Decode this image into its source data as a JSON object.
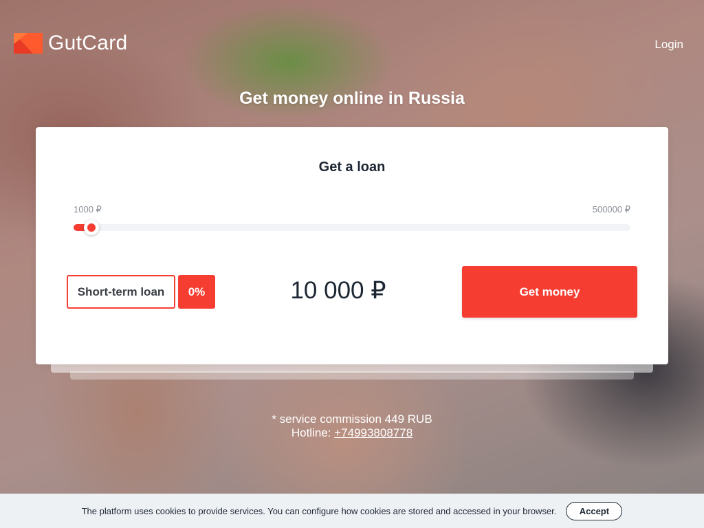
{
  "brand": {
    "name": "GutCard",
    "accent_color": "#f53d32",
    "logo_icon": "flag-logo-icon"
  },
  "header": {
    "login_label": "Login"
  },
  "hero": {
    "title": "Get money online in Russia"
  },
  "loan_card": {
    "title": "Get a loan",
    "slider": {
      "min_label": "1000 ₽",
      "max_label": "500000 ₽",
      "min": 1000,
      "max": 500000,
      "value": 10000
    },
    "loan_type_label": "Short-term loan",
    "rate_label": "0%",
    "amount_display": "10 000 ₽",
    "submit_label": "Get money"
  },
  "notes": {
    "commission": "* service commission 449 RUB",
    "hotline_label": "Hotline:",
    "hotline_number": "+74993808778"
  },
  "cookie_bar": {
    "text": "The platform uses cookies to provide services. You can configure how cookies are stored and accessed in your browser.",
    "accept_label": "Accept"
  }
}
